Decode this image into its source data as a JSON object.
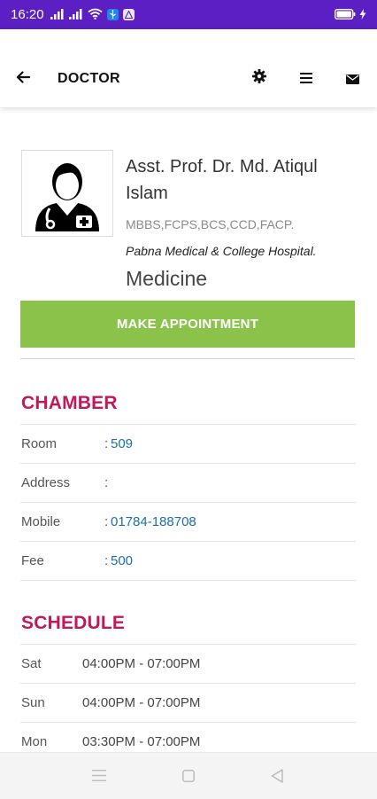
{
  "status_bar": {
    "time": "16:20",
    "signal1": "signal-bars-icon",
    "signal2": "signal-bars-icon",
    "wifi": "wifi-icon",
    "usb": "usb-icon",
    "app_badge": "app-badge-icon",
    "battery": "battery-icon",
    "charging": "charging-bolt-icon"
  },
  "app_bar": {
    "title": "DOCTOR",
    "back_icon": "arrow-left-icon",
    "settings_icon": "gear-icon",
    "menu_icon": "hamburger-icon",
    "mail_icon": "envelope-icon"
  },
  "doctor": {
    "name": "Asst. Prof. Dr. Md. Atiqul Islam",
    "degrees": "MBBS,FCPS,BCS,CCD,FACP.",
    "hospital": "Pabna Medical & College Hospital.",
    "department": "Medicine",
    "photo_icon": "doctor-avatar-icon"
  },
  "appointment_button": "MAKE APPOINTMENT",
  "chamber": {
    "title": "CHAMBER",
    "rows": [
      {
        "label": "Room",
        "colon": ":",
        "value": "509"
      },
      {
        "label": "Address",
        "colon": ":",
        "value": ""
      },
      {
        "label": "Mobile",
        "colon": ":",
        "value": "01784-188708"
      },
      {
        "label": "Fee",
        "colon": ":",
        "value": "500"
      }
    ]
  },
  "schedule": {
    "title": "SCHEDULE",
    "rows": [
      {
        "day": "Sat",
        "time": "04:00PM - 07:00PM"
      },
      {
        "day": "Sun",
        "time": "04:00PM - 07:00PM"
      },
      {
        "day": "Mon",
        "time": "03:30PM - 07:00PM"
      }
    ]
  },
  "colors": {
    "status_bar": "#5b1fc4",
    "button": "#8bc34a",
    "section_title": "#c2185b",
    "value": "#1a6fa8"
  },
  "nav_bar": {
    "recent": "recent-apps-icon",
    "home": "home-icon",
    "back": "back-triangle-icon"
  }
}
